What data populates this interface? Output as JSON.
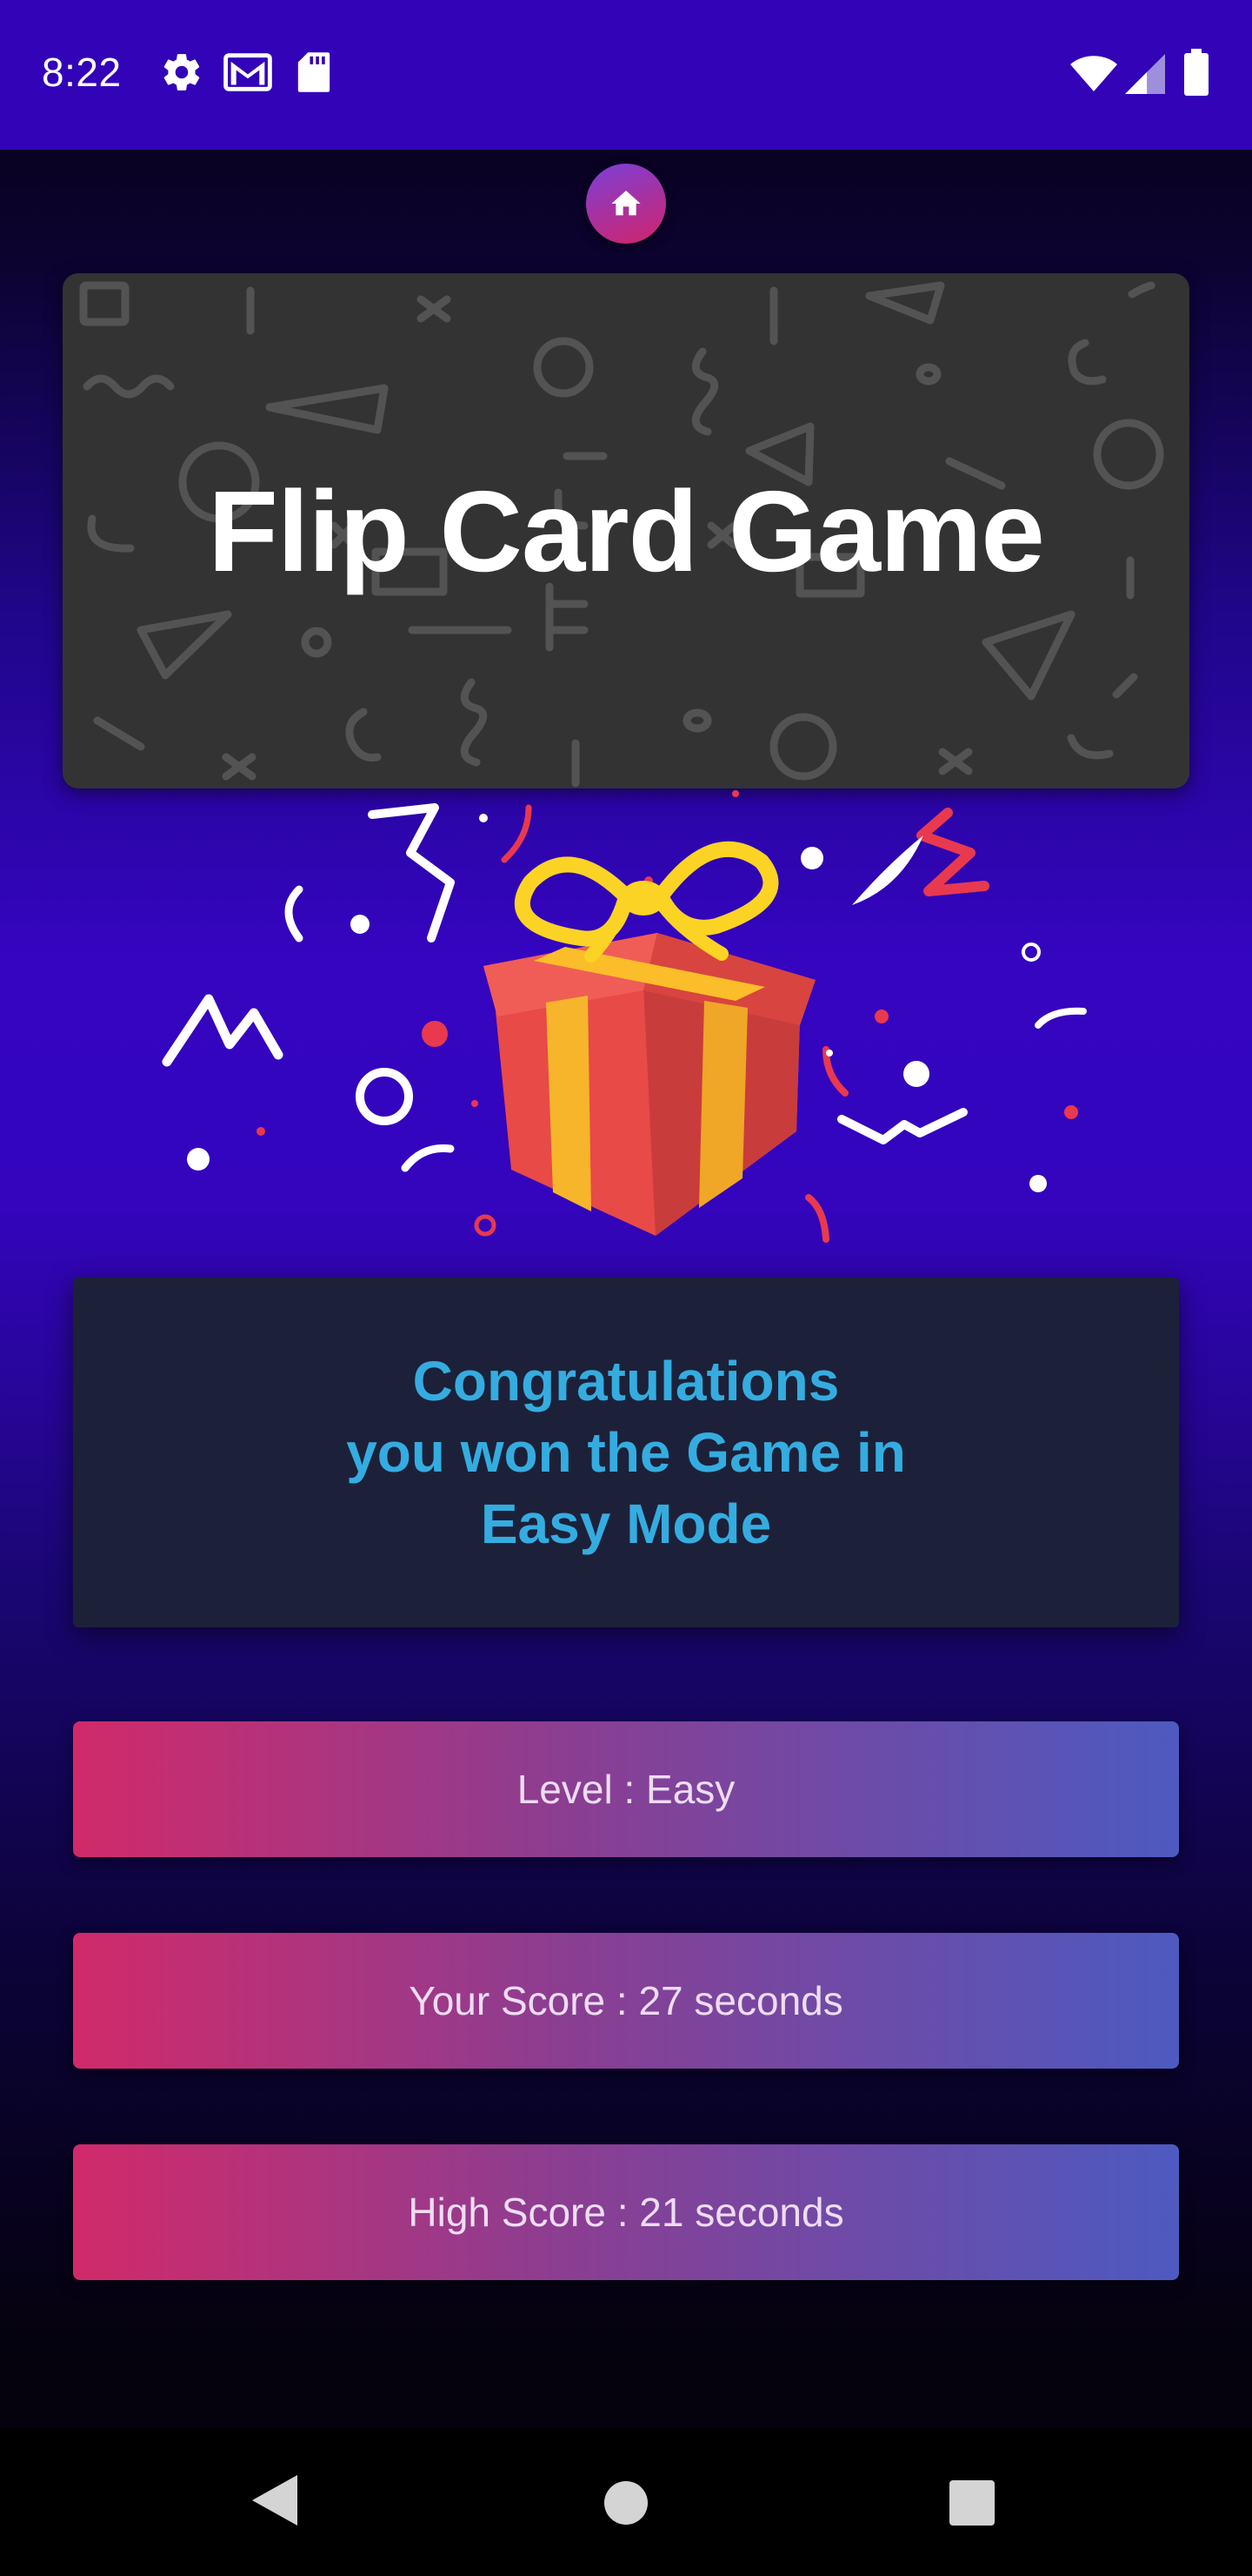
{
  "status_bar": {
    "time": "8:22",
    "icons": [
      "gear-icon",
      "gmail-icon",
      "sd-card-icon",
      "wifi-icon",
      "signal-icon",
      "battery-icon"
    ]
  },
  "home_button": {
    "icon": "home-icon"
  },
  "banner": {
    "title": "Flip Card Game"
  },
  "illustration": {
    "icon": "gift-icon"
  },
  "congrats": {
    "line1": "Congratulations",
    "line2": "you won the Game in",
    "line3": "Easy Mode"
  },
  "stats": {
    "level": "Level : Easy",
    "your_score": "Your Score : 27 seconds",
    "high_score": "High Score : 21 seconds"
  },
  "nav": {
    "icons": [
      "back-icon",
      "home-circle-icon",
      "recents-icon"
    ]
  },
  "colors": {
    "status_bar": "#3303b8",
    "accent_text": "#35ace0",
    "gradient_start": "#d12a6a",
    "gradient_end": "#4d5ac0"
  }
}
